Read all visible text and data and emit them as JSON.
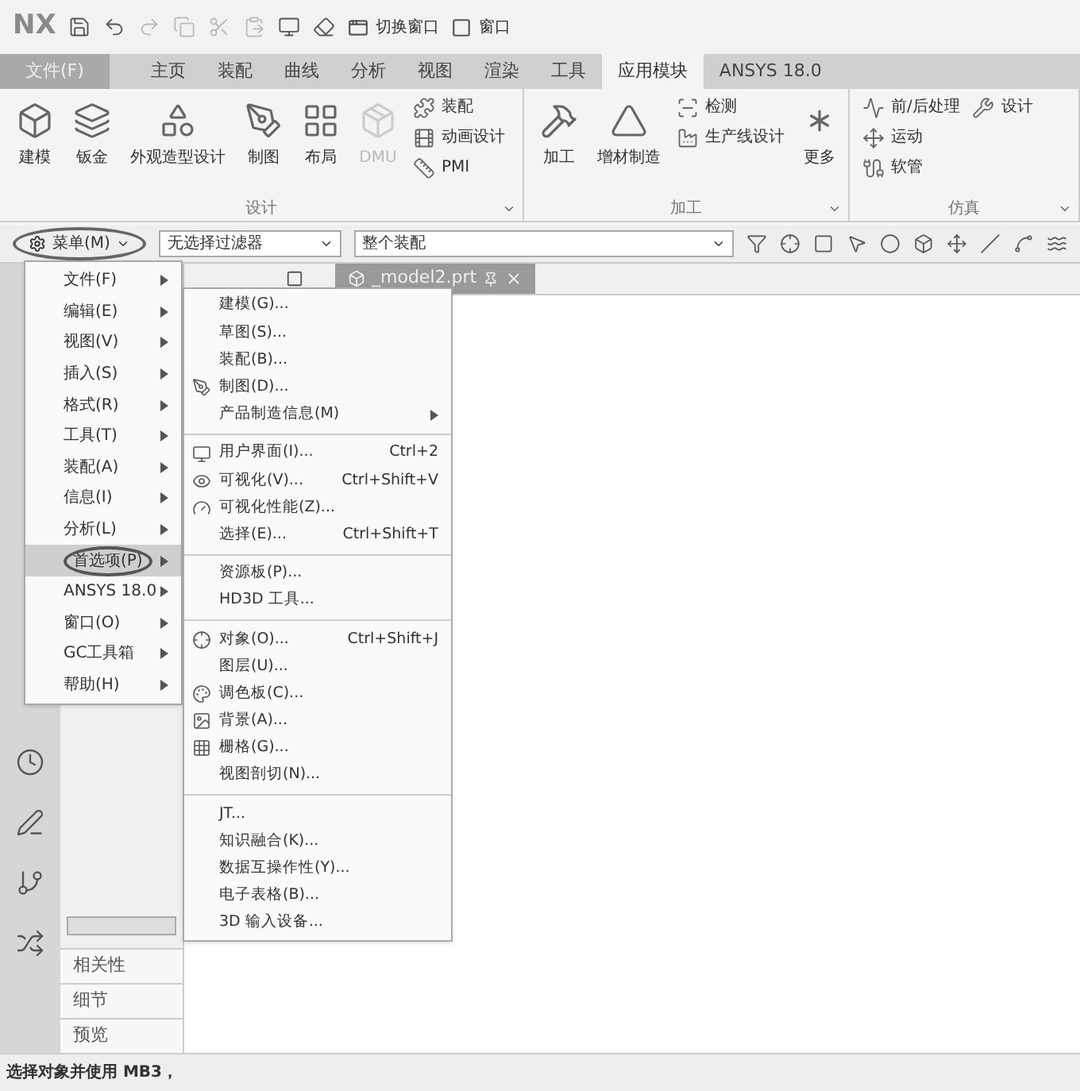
{
  "quick_access": {
    "logo": "NX",
    "switch_window": "切换窗口",
    "window": "窗口"
  },
  "ribbon": {
    "file_tab": "文件(F)",
    "tabs": [
      {
        "label": "主页",
        "selected": false
      },
      {
        "label": "装配",
        "selected": false
      },
      {
        "label": "曲线",
        "selected": false
      },
      {
        "label": "分析",
        "selected": false
      },
      {
        "label": "视图",
        "selected": false
      },
      {
        "label": "渲染",
        "selected": false
      },
      {
        "label": "工具",
        "selected": false
      },
      {
        "label": "应用模块",
        "selected": true
      },
      {
        "label": "ANSYS 18.0",
        "selected": false
      }
    ],
    "groups": [
      {
        "title": "设计",
        "items": [
          {
            "label": "建模",
            "kind": "large",
            "disabled": false
          },
          {
            "label": "钣金",
            "kind": "large",
            "disabled": false
          },
          {
            "label": "外观造型设计",
            "kind": "large",
            "disabled": false
          },
          {
            "label": "制图",
            "kind": "large",
            "disabled": false
          },
          {
            "label": "布局",
            "kind": "large",
            "disabled": false
          },
          {
            "label": "DMU",
            "kind": "large",
            "disabled": true
          },
          {
            "label": "装配",
            "kind": "small",
            "disabled": false
          },
          {
            "label": "动画设计",
            "kind": "small",
            "disabled": false
          },
          {
            "label": "PMI",
            "kind": "small",
            "disabled": false
          }
        ]
      },
      {
        "title": "加工",
        "items": [
          {
            "label": "加工",
            "kind": "large",
            "disabled": false
          },
          {
            "label": "增材制造",
            "kind": "large",
            "disabled": false
          },
          {
            "label": "检测",
            "kind": "small",
            "disabled": false
          },
          {
            "label": "生产线设计",
            "kind": "small",
            "disabled": false
          },
          {
            "label": "更多",
            "kind": "large",
            "disabled": false
          }
        ]
      },
      {
        "title": "仿真",
        "items": [
          {
            "label": "前/后处理",
            "kind": "small",
            "disabled": false
          },
          {
            "label": "运动",
            "kind": "small",
            "disabled": false
          },
          {
            "label": "软管",
            "kind": "small",
            "disabled": false
          },
          {
            "label": "设计",
            "kind": "small",
            "disabled": false
          }
        ]
      }
    ]
  },
  "toolbar": {
    "menu_button": "菜单(M)",
    "filters": [
      "无选择过滤器",
      "整个装配"
    ]
  },
  "main_menu": {
    "items": [
      {
        "label": "文件(F)",
        "selected": false
      },
      {
        "label": "编辑(E)",
        "selected": false
      },
      {
        "label": "视图(V)",
        "selected": false
      },
      {
        "label": "插入(S)",
        "selected": false
      },
      {
        "label": "格式(R)",
        "selected": false
      },
      {
        "label": "工具(T)",
        "selected": false
      },
      {
        "label": "装配(A)",
        "selected": false
      },
      {
        "label": "信息(I)",
        "selected": false
      },
      {
        "label": "分析(L)",
        "selected": false
      },
      {
        "label": "首选项(P)",
        "selected": true
      },
      {
        "label": "ANSYS 18.0",
        "selected": false
      },
      {
        "label": "窗口(O)",
        "selected": false
      },
      {
        "label": "GC工具箱",
        "selected": false
      },
      {
        "label": "帮助(H)",
        "selected": false
      }
    ]
  },
  "submenu": {
    "sections": [
      [
        {
          "label": "建模(G)...",
          "kind": "text"
        },
        {
          "label": "草图(S)...",
          "kind": "text"
        },
        {
          "label": "装配(B)...",
          "kind": "text"
        },
        {
          "label": "制图(D)...",
          "kind": "icon"
        },
        {
          "label": "产品制造信息(M)",
          "kind": "cascade"
        }
      ],
      [
        {
          "label": "用户界面(I)...",
          "kind": "icon",
          "shortcut": "Ctrl+2"
        },
        {
          "label": "可视化(V)...",
          "kind": "icon",
          "shortcut": "Ctrl+Shift+V"
        },
        {
          "label": "可视化性能(Z)...",
          "kind": "icon"
        },
        {
          "label": "选择(E)...",
          "kind": "text",
          "shortcut": "Ctrl+Shift+T"
        }
      ],
      [
        {
          "label": "资源板(P)...",
          "kind": "text"
        },
        {
          "label": "HD3D 工具...",
          "kind": "text"
        }
      ],
      [
        {
          "label": "对象(O)...",
          "kind": "icon",
          "shortcut": "Ctrl+Shift+J"
        },
        {
          "label": "图层(U)...",
          "kind": "text"
        },
        {
          "label": "调色板(C)...",
          "kind": "icon"
        },
        {
          "label": "背景(A)...",
          "kind": "icon"
        },
        {
          "label": "栅格(G)...",
          "kind": "icon"
        },
        {
          "label": "视图剖切(N)...",
          "kind": "text"
        }
      ],
      [
        {
          "label": "JT...",
          "kind": "text"
        },
        {
          "label": "知识融合(K)...",
          "kind": "text"
        },
        {
          "label": "数据互操作性(Y)...",
          "kind": "text"
        },
        {
          "label": "电子表格(B)...",
          "kind": "text"
        },
        {
          "label": "3D 输入设备...",
          "kind": "text"
        }
      ]
    ]
  },
  "document_tab": {
    "title": "_model2.prt"
  },
  "navigator": {
    "items": [
      "相关性",
      "细节",
      "预览"
    ]
  },
  "status_bar": "选择对象并使用 MB3，"
}
